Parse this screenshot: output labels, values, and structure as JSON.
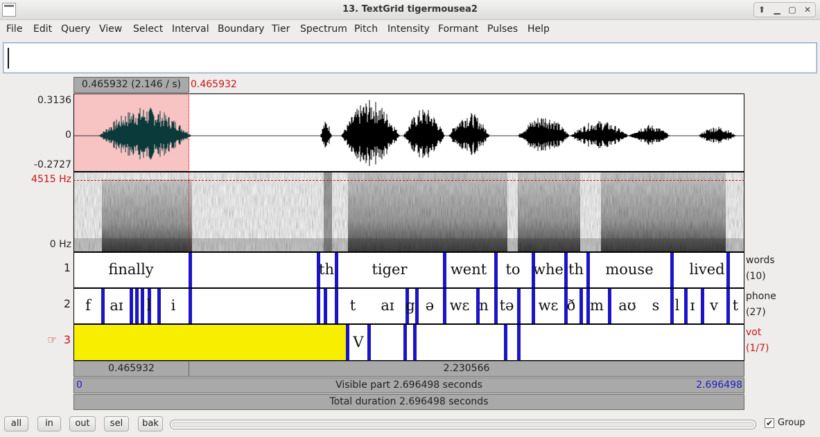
{
  "window": {
    "title": "13. TextGrid tigermousea2"
  },
  "menu": [
    "File",
    "Edit",
    "Query",
    "View",
    "Select",
    "Interval",
    "Boundary",
    "Tier",
    "Spectrum",
    "Pitch",
    "Intensity",
    "Formant",
    "Pulses",
    "Help"
  ],
  "text_entry": {
    "value": ""
  },
  "selection_display": "0.465932 (2.146 / s)",
  "cursor_time": "0.465932",
  "waveform": {
    "ymax": "0.3136",
    "ymid": "0",
    "ymin": "-0.2727"
  },
  "spectrogram": {
    "fmax": "4515 Hz",
    "fmin": "0 Hz"
  },
  "tiers": [
    {
      "number": "1",
      "name": "words",
      "count": "(10)",
      "labels": [
        "finally",
        "th",
        "tiger",
        "went",
        "to",
        "whe",
        "th",
        "mouse",
        "lived"
      ]
    },
    {
      "number": "2",
      "name": "phone",
      "count": "(27)",
      "labels": [
        "f",
        "aɪ",
        "l",
        "i",
        "t",
        "aɪ",
        "g",
        "ə",
        "wɛ",
        "n",
        "tə",
        "wɛ",
        "ð",
        "m",
        "aʊ",
        "s",
        "l",
        "ɪ",
        "v",
        "t"
      ]
    },
    {
      "number": "3",
      "pointer": "☞",
      "name": "vot",
      "count": "(1/7)",
      "labels": [
        "V"
      ]
    }
  ],
  "duration_bar": {
    "left": "0.465932",
    "right": "2.230566"
  },
  "visible_bar": {
    "start": "0",
    "label": "Visible part 2.696498 seconds",
    "end": "2.696498"
  },
  "total_bar": {
    "label": "Total duration 2.696498 seconds"
  },
  "buttons": {
    "all": "all",
    "in": "in",
    "out": "out",
    "sel": "sel",
    "bak": "bak"
  },
  "group": {
    "label": "Group",
    "checked": true
  },
  "colors": {
    "boundary": "#1b14c8",
    "selection_wave": "#f7c3c3",
    "vot_selection": "#f8ef00",
    "cursor": "#cc1111"
  }
}
